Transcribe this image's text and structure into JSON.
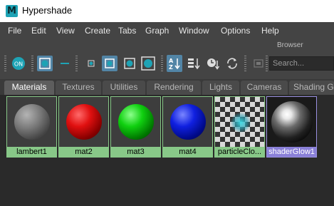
{
  "window": {
    "title": "Hypershade",
    "app_icon_letter": "M"
  },
  "menu": [
    "File",
    "Edit",
    "View",
    "Create",
    "Tabs",
    "Graph",
    "Window",
    "Options",
    "Help"
  ],
  "toolbar": {
    "section_label": "Browser",
    "on_label": "ON",
    "search_placeholder": "Search..."
  },
  "tabs": [
    {
      "label": "Materials",
      "active": true
    },
    {
      "label": "Textures",
      "active": false
    },
    {
      "label": "Utilities",
      "active": false
    },
    {
      "label": "Rendering",
      "active": false
    },
    {
      "label": "Lights",
      "active": false
    },
    {
      "label": "Cameras",
      "active": false
    },
    {
      "label": "Shading G",
      "active": false
    }
  ],
  "materials": [
    {
      "name": "lambert1",
      "color": "#8c8c8c",
      "selected": false
    },
    {
      "name": "mat2",
      "color": "#e01010",
      "selected": false
    },
    {
      "name": "mat3",
      "color": "#10d010",
      "selected": false
    },
    {
      "name": "mat4",
      "color": "#1020e0",
      "selected": false
    },
    {
      "name": "particleClo...",
      "color": "#30c8d8",
      "selected": false
    },
    {
      "name": "shaderGlow1",
      "color": "#ffffff",
      "selected": true
    }
  ],
  "colors": {
    "label_green": "#88c888",
    "label_selected": "#8a80d8",
    "toolbar_active": "#5285a6"
  }
}
